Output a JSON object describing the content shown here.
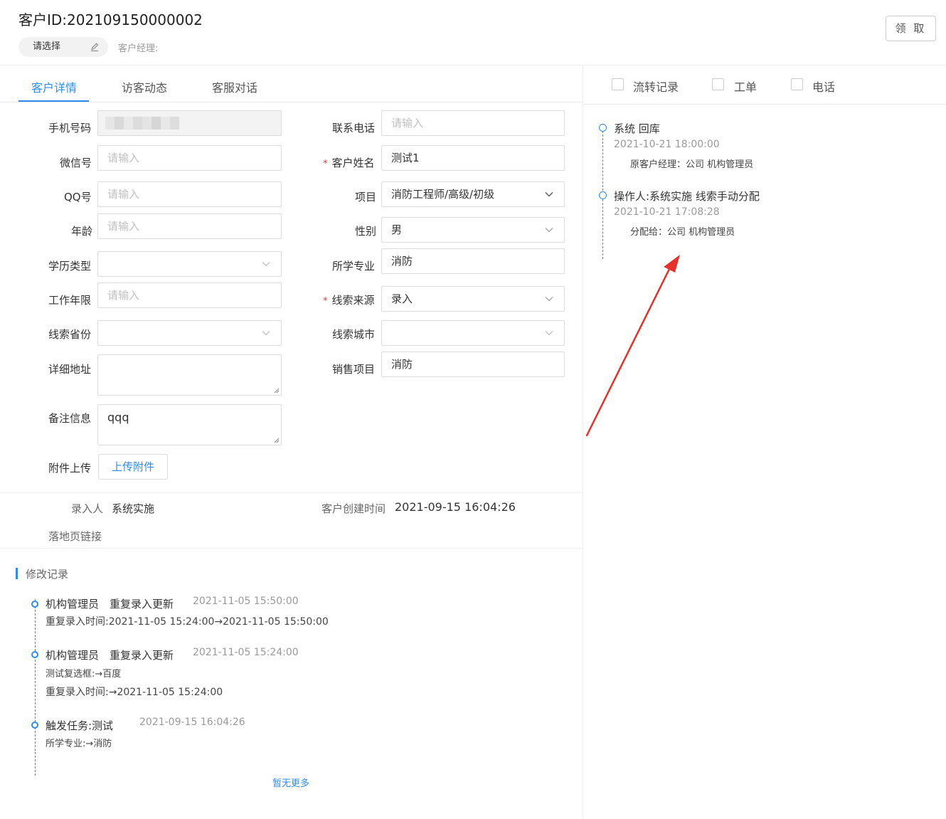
{
  "header": {
    "title": "客户ID:202109150000002",
    "manager_select": "请选择",
    "manager_label": "客户经理:",
    "claim_button": "领 取"
  },
  "tabs": [
    "客户详情",
    "访客动态",
    "客服对话"
  ],
  "form": {
    "phone": {
      "label": "手机号码"
    },
    "contact_phone": {
      "label": "联系电话",
      "placeholder": "请输入"
    },
    "wechat": {
      "label": "微信号",
      "placeholder": "请输入"
    },
    "customer_name": {
      "label": "客户姓名",
      "value": "测试1",
      "required": "*"
    },
    "qq": {
      "label": "QQ号",
      "placeholder": "请输入"
    },
    "project": {
      "label": "项目",
      "value": "消防工程师/高级/初级"
    },
    "age": {
      "label": "年龄",
      "placeholder": "请输入"
    },
    "gender": {
      "label": "性别",
      "value": "男"
    },
    "education": {
      "label": "学历类型",
      "value": ""
    },
    "major": {
      "label": "所学专业",
      "value": "消防"
    },
    "work_years": {
      "label": "工作年限",
      "placeholder": "请输入"
    },
    "lead_source": {
      "label": "线索来源",
      "value": "录入",
      "required": "*"
    },
    "province": {
      "label": "线索省份",
      "value": ""
    },
    "city": {
      "label": "线索城市",
      "value": ""
    },
    "address": {
      "label": "详细地址",
      "value": ""
    },
    "sales_project": {
      "label": "销售项目",
      "value": "消防"
    },
    "remark": {
      "label": "备注信息",
      "value": "qqq"
    },
    "attachment": {
      "label": "附件上传",
      "button": "上传附件"
    }
  },
  "info": {
    "entered_by_label": "录入人",
    "entered_by": "系统实施",
    "created_label": "客户创建时间",
    "created_at": "2021-09-15 16:04:26",
    "landing_label": "落地页链接"
  },
  "history": {
    "title": "修改记录",
    "items": [
      {
        "title": "机构管理员　重复录入更新",
        "time": "2021-11-05 15:50:00",
        "details": [
          "重复录入时间:2021-11-05 15:24:00→2021-11-05 15:50:00"
        ]
      },
      {
        "title": "机构管理员　重复录入更新",
        "time": "2021-11-05 15:24:00",
        "details": [
          "测试复选框:→百度",
          "重复录入时间:→2021-11-05 15:24:00"
        ]
      },
      {
        "title": "触发任务:测试",
        "time": "2021-09-15 16:04:26",
        "details": [
          "所学专业:→消防"
        ]
      }
    ],
    "no_more": "暂无更多"
  },
  "right": {
    "filters": [
      "流转记录",
      "工单",
      "电话"
    ],
    "timeline": [
      {
        "title": "系统 回库",
        "time": "2021-10-21 18:00:00",
        "detail": "原客户经理：公司 机构管理员"
      },
      {
        "title": "操作人:系统实施 线索手动分配",
        "time": "2021-10-21 17:08:28",
        "detail": "分配给：公司 机构管理员"
      }
    ]
  },
  "colors": {
    "accent": "#2d8cf0",
    "required": "#e4393c",
    "annotation_arrow": "#e8302a"
  },
  "icons": [
    "edit-icon",
    "chevron-down-icon",
    "timeline-dot-icon",
    "annotation-arrow"
  ]
}
